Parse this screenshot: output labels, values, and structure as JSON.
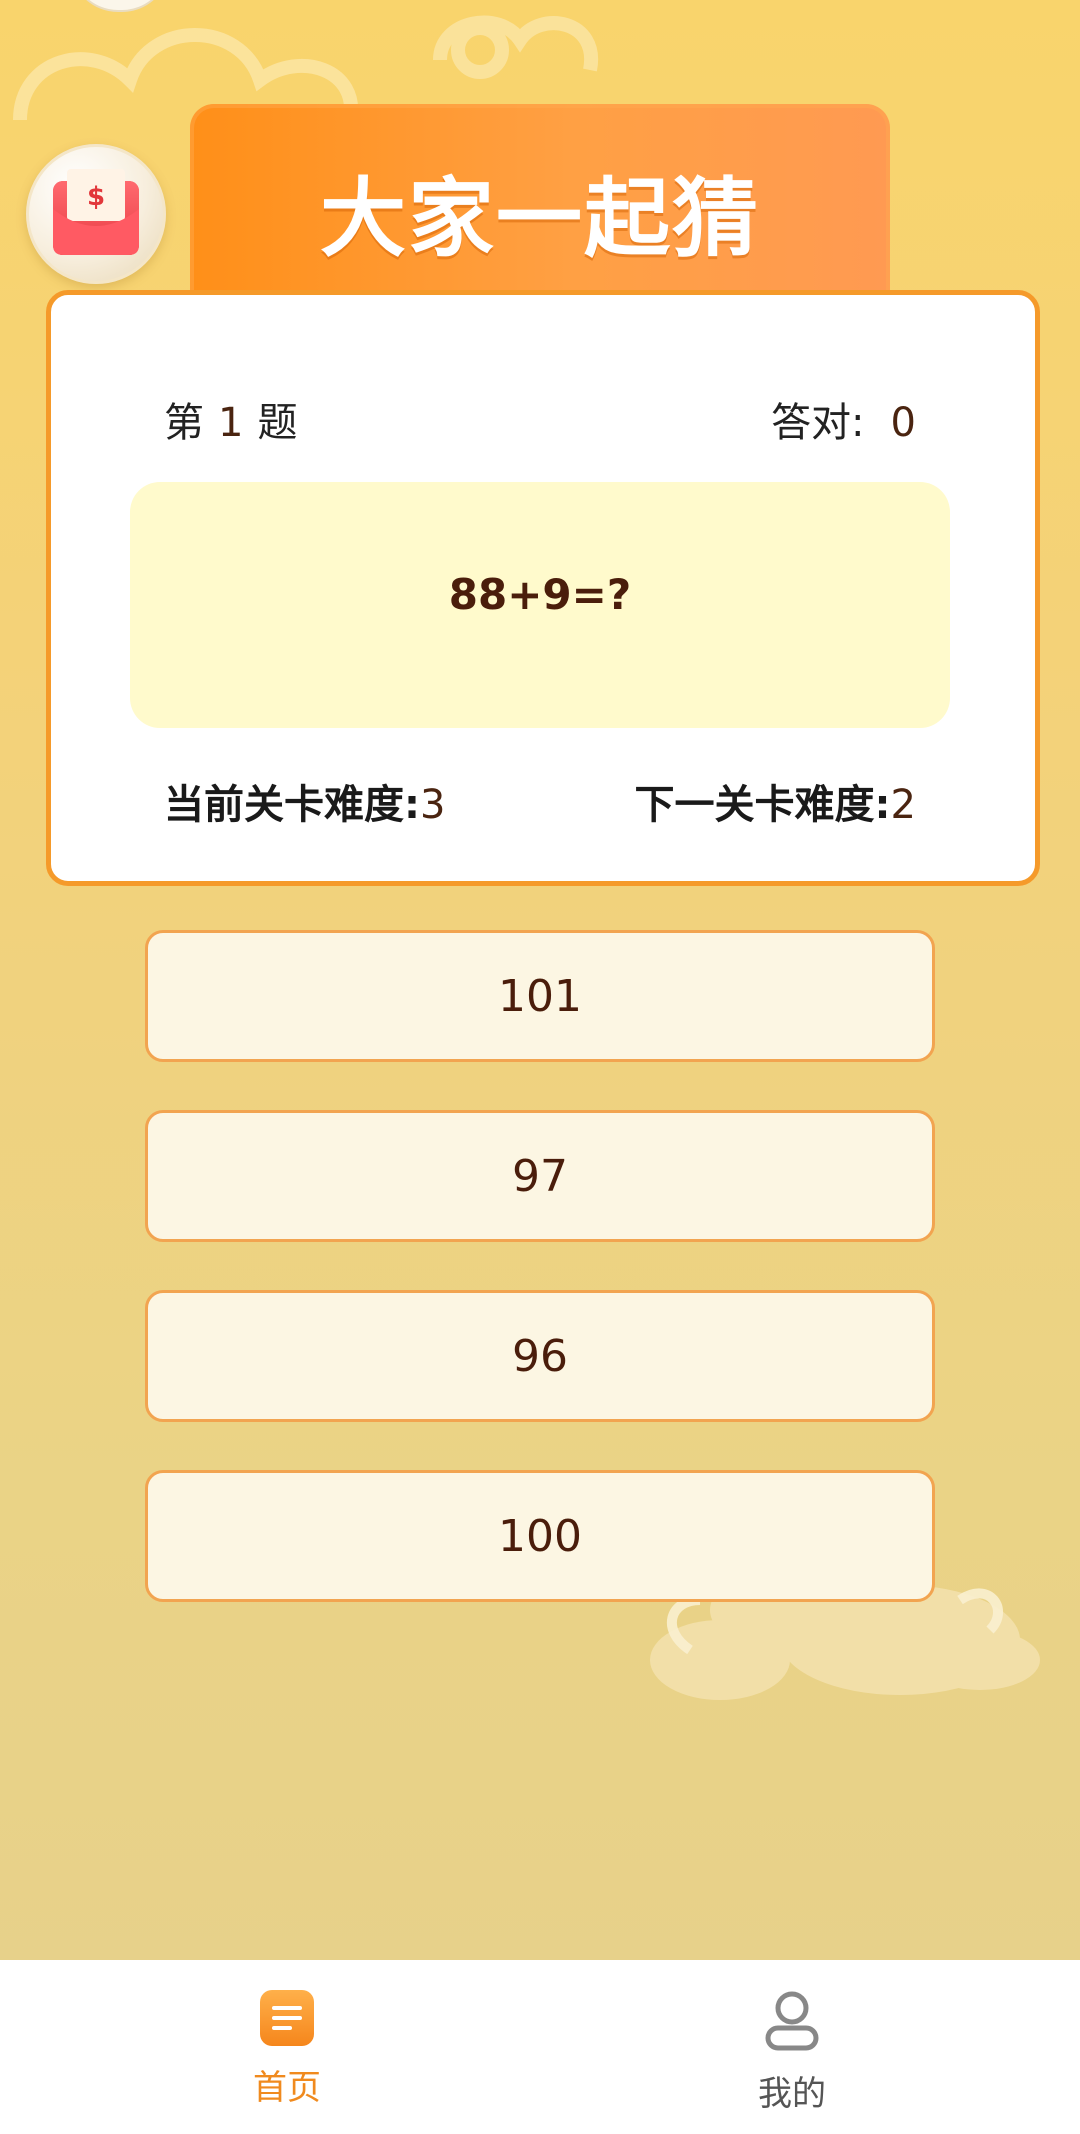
{
  "header": {
    "title": "大家一起猜"
  },
  "quiz": {
    "index_prefix": "第",
    "index_number": "1",
    "index_suffix": "题",
    "correct_label": "答对:",
    "correct_count": "0",
    "question": "88+9=?",
    "current_difficulty_label": "当前关卡难度:",
    "current_difficulty": "3",
    "next_difficulty_label": "下一关卡难度:",
    "next_difficulty": "2"
  },
  "answers": [
    "101",
    "97",
    "96",
    "100"
  ],
  "bottom_nav": {
    "items": [
      {
        "label": "首页",
        "icon": "document-list-icon",
        "active": true
      },
      {
        "label": "我的",
        "icon": "user-icon",
        "active": false
      }
    ]
  },
  "colors": {
    "accent": "#f59a2a",
    "title_tab": "#ff9a30",
    "question_box": "#fffacc",
    "answer_bg": "#fcf6e3",
    "text_dark": "#4a1d0b"
  }
}
